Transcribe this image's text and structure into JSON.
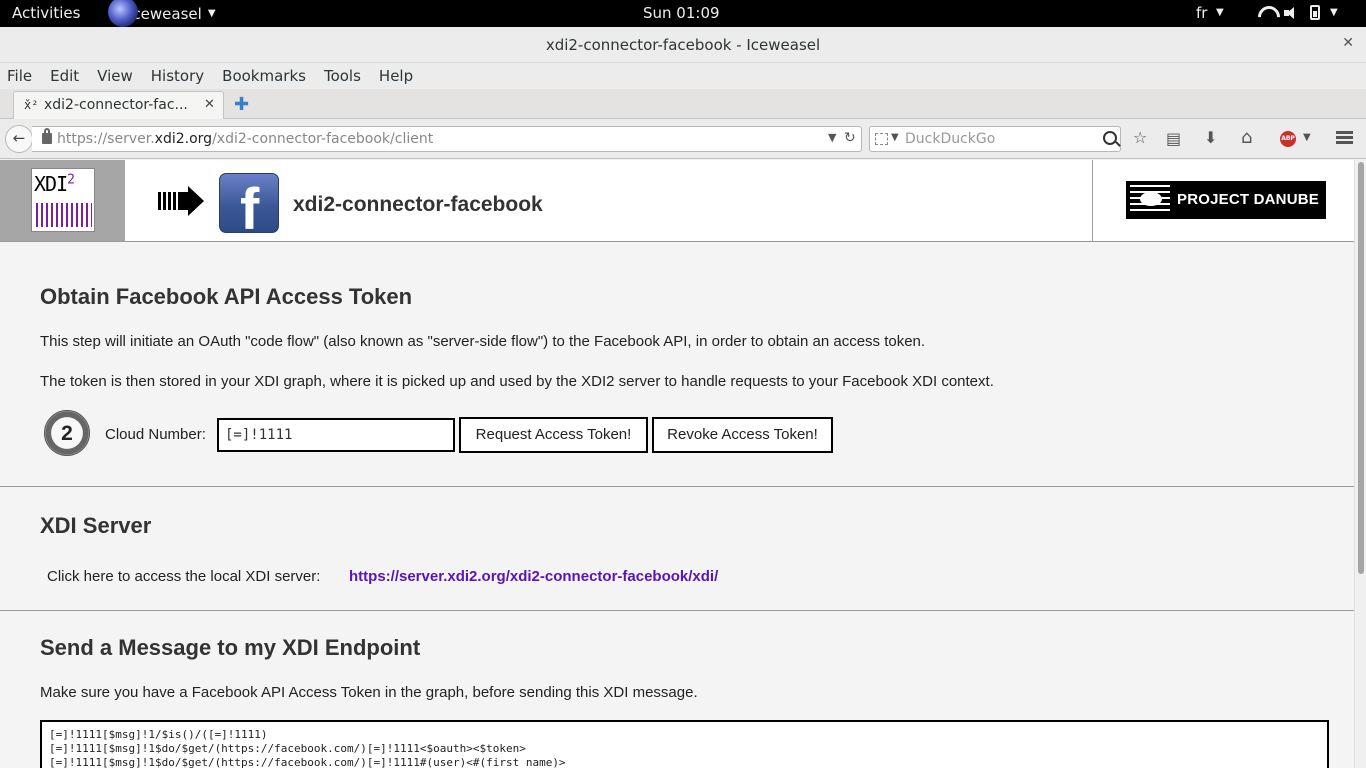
{
  "topbar": {
    "activities": "Activities",
    "app_name": "Iceweasel",
    "clock": "Sun 01:09",
    "lang": "fr"
  },
  "window": {
    "title": "xdi2-connector-facebook - Iceweasel"
  },
  "menubar": [
    "File",
    "Edit",
    "View",
    "History",
    "Bookmarks",
    "Tools",
    "Help"
  ],
  "tabs": [
    {
      "label": "xdi2-connector-fac..."
    }
  ],
  "navbar": {
    "url_prefix": "https://server.",
    "url_domain": "xdi2.org",
    "url_path": "/xdi2-connector-facebook/client",
    "search_placeholder": "DuckDuckGo"
  },
  "header": {
    "title": "xdi2-connector-facebook",
    "danube_text": "PROJECT DANUBE"
  },
  "token_section": {
    "heading": "Obtain Facebook API Access Token",
    "para1": "This step will initiate an OAuth \"code flow\" (also known as \"server-side flow\") to the Facebook API, in order to obtain an access token.",
    "para2": "The token is then stored in your XDI graph, where it is picked up and used by the XDI2 server to handle requests to your Facebook XDI context.",
    "cloud_number_label": "Cloud Number:",
    "cloud_number_value": "[=]!1111",
    "request_button": "Request Access Token!",
    "revoke_button": "Revoke Access Token!"
  },
  "server_section": {
    "heading": "XDI Server",
    "label": "Click here to access the local XDI server:",
    "link": "https://server.xdi2.org/xdi2-connector-facebook/xdi/"
  },
  "message_section": {
    "heading": "Send a Message to my XDI Endpoint",
    "para": "Make sure you have a Facebook API Access Token in the graph, before sending this XDI message.",
    "lines": [
      "[=]!1111[$msg]!1/$is()/([=]!1111)",
      "[=]!1111[$msg]!1$do/$get/(https://facebook.com/)[=]!1111<$oauth><$token>",
      "[=]!1111[$msg]!1$do/$get/(https://facebook.com/)[=]!1111#(user)<#(first_name)>"
    ]
  },
  "colors": {
    "link": "#5a14b8",
    "xdi_purple": "#7b1fa2",
    "facebook_blue": "#3b5998"
  }
}
